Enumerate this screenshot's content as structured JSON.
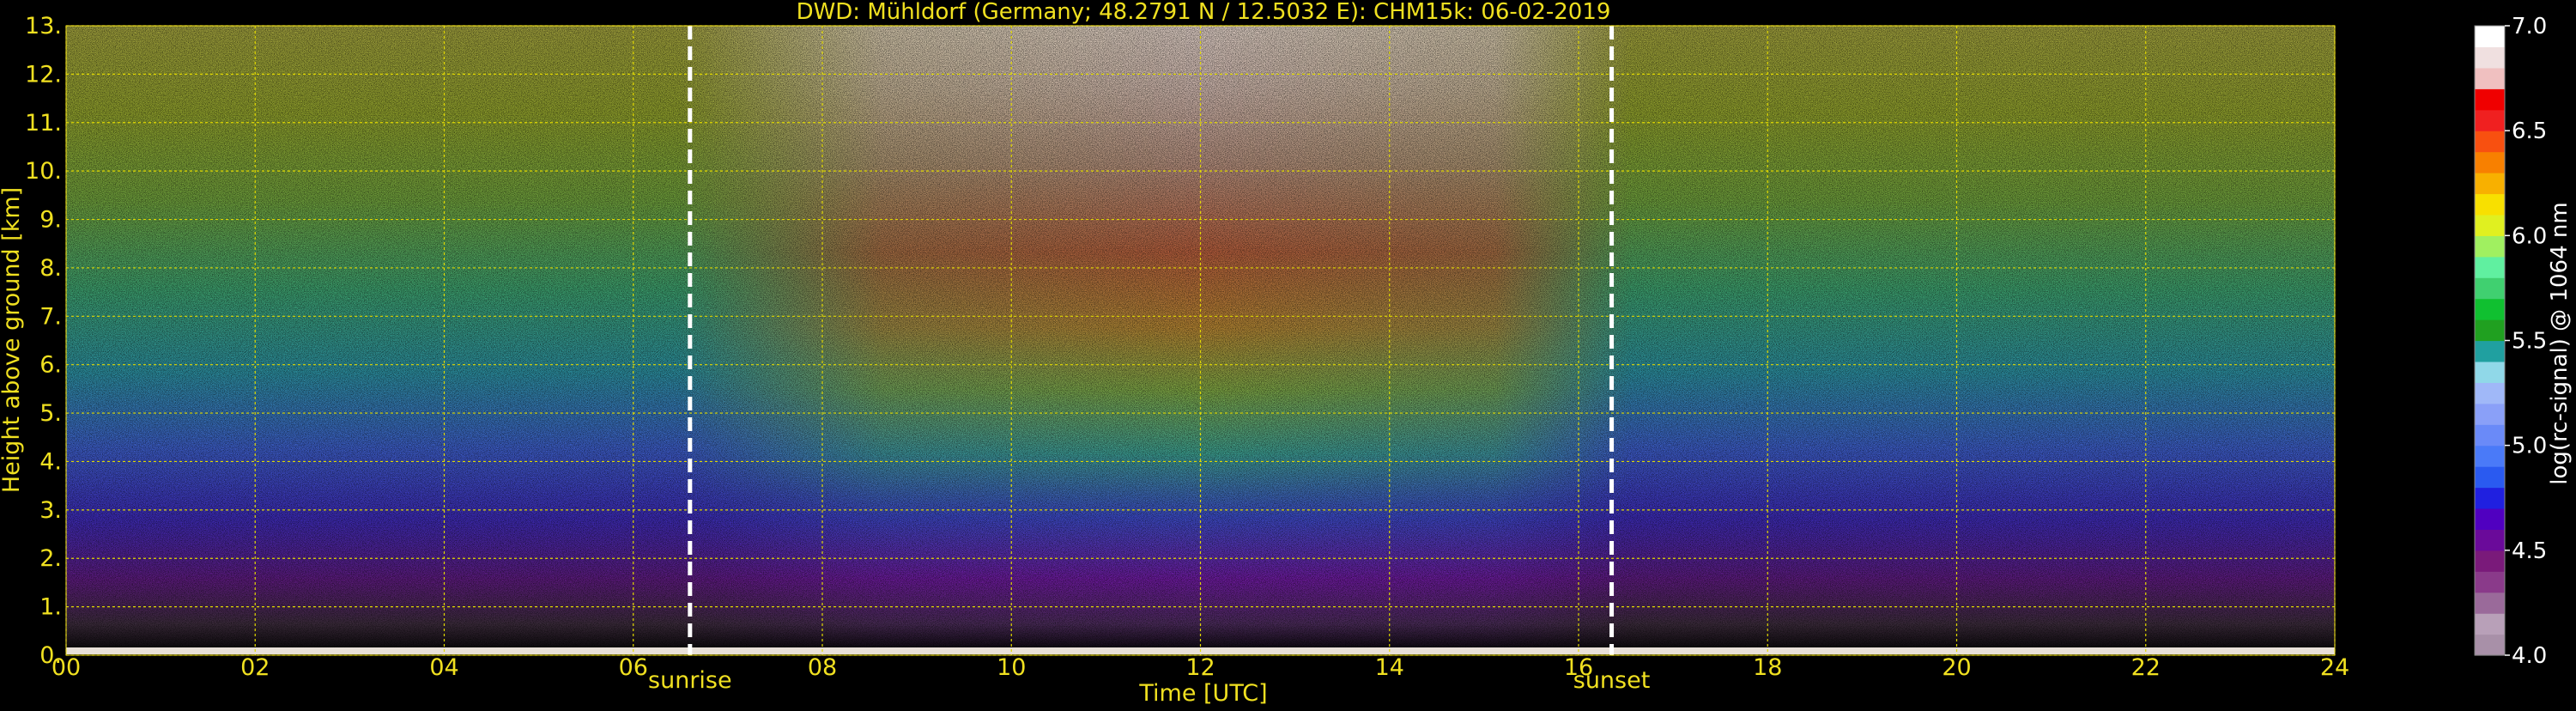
{
  "chart_data": {
    "type": "heatmap",
    "title": "DWD: Mühldorf (Germany; 48.2791 N / 12.5032 E):    CHM15k: 06-02-2019",
    "xlabel": "Time [UTC]",
    "ylabel": "Height above ground [km]",
    "xlim": [
      0,
      24
    ],
    "ylim": [
      0,
      13
    ],
    "x_ticks": [
      "00",
      "02",
      "04",
      "06",
      "08",
      "10",
      "12",
      "14",
      "16",
      "18",
      "20",
      "22",
      "24"
    ],
    "y_ticks": [
      "0.",
      "1.",
      "2.",
      "3.",
      "4.",
      "5.",
      "6.",
      "7.",
      "8.",
      "9.",
      "10.",
      "11.",
      "12.",
      "13."
    ],
    "grid": true,
    "annotations": [
      {
        "label": "sunrise",
        "time": 6.6
      },
      {
        "label": "sunset",
        "time": 16.35
      }
    ],
    "colorbar": {
      "label": "log(rc-signal) @ 1064 nm",
      "range": [
        4.0,
        7.0
      ],
      "ticks": [
        "4.0",
        "4.5",
        "5.0",
        "5.5",
        "6.0",
        "6.5",
        "7.0"
      ],
      "colors": [
        "#a890a8",
        "#b8a0b8",
        "#9a6a9a",
        "#8a3a8a",
        "#7a1a7a",
        "#6a0a9a",
        "#5000c0",
        "#2020e0",
        "#2a5af0",
        "#4a7af8",
        "#6a8af8",
        "#8aa0f8",
        "#a0b8f8",
        "#90d8e8",
        "#20a0a0",
        "#20a020",
        "#10c030",
        "#40d070",
        "#60f0a0",
        "#a0f060",
        "#e0f020",
        "#f8e000",
        "#f8b000",
        "#f88000",
        "#f85010",
        "#f02020",
        "#f00000",
        "#f0c0c0",
        "#f0e0e0",
        "#ffffff"
      ]
    },
    "colors": {
      "text": "#f0e020",
      "grid": "#e0d800",
      "background": "#000000",
      "colorbar_text": "#ffffff"
    }
  }
}
